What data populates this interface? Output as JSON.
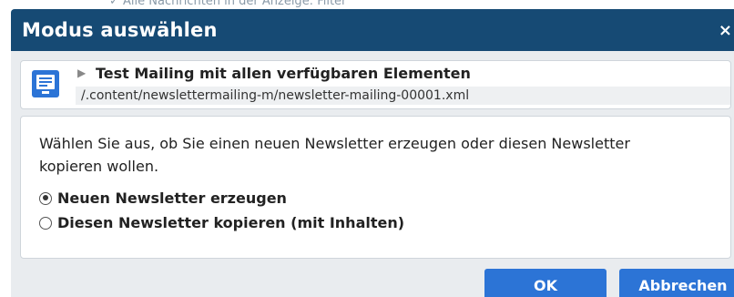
{
  "background": {
    "text": "✓     Alle Nachrichten in der Anzeige: Filter"
  },
  "dialog": {
    "title": "Modus auswählen",
    "close_glyph": "×"
  },
  "resource": {
    "icon": "newsletter-document-icon",
    "title": "Test Mailing mit allen verfügbaren Elementen",
    "path": "/.content/newslettermailing-m/newsletter-mailing-00001.xml"
  },
  "content": {
    "description": "Wählen Sie aus, ob Sie einen neuen Newsletter erzeugen oder diesen Newsletter kopieren wollen.",
    "options": [
      {
        "label": "Neuen Newsletter erzeugen",
        "checked": true
      },
      {
        "label": "Diesen Newsletter kopieren (mit Inhalten)",
        "checked": false
      }
    ]
  },
  "buttons": {
    "ok": "OK",
    "cancel": "Abbrechen"
  },
  "colors": {
    "titlebar": "#164a74",
    "button": "#2c74d6",
    "dialog_bg": "#e9ecef"
  }
}
